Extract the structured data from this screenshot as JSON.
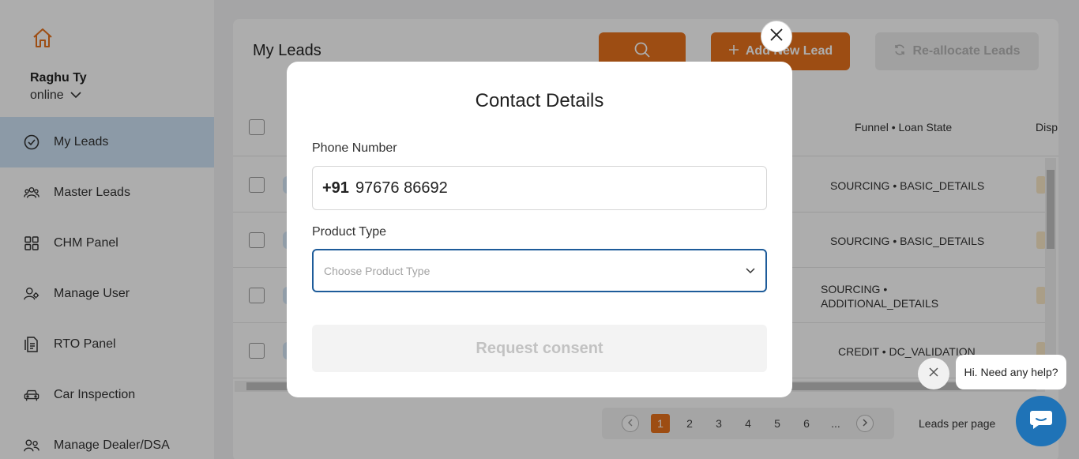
{
  "sidebar": {
    "user_name": "Raghu Ty",
    "user_status": "online",
    "items": [
      {
        "label": "My Leads",
        "icon": "check-circle-icon",
        "active": true
      },
      {
        "label": "Master Leads",
        "icon": "users-icon"
      },
      {
        "label": "CHM Panel",
        "icon": "grid-icon"
      },
      {
        "label": "Manage User",
        "icon": "user-gear-icon"
      },
      {
        "label": "RTO Panel",
        "icon": "document-icon"
      },
      {
        "label": "Car Inspection",
        "icon": "car-icon"
      },
      {
        "label": "Manage Dealer/DSA",
        "icon": "users-icon"
      }
    ]
  },
  "main": {
    "title": "My Leads",
    "add_lead_label": "Add New Lead",
    "reallocate_label": "Re-allocate Leads",
    "columns": {
      "funnel": "Funnel • Loan State",
      "disposition": "Disp"
    },
    "rows": [
      {
        "state": "SOURCING • BASIC_DETAILS"
      },
      {
        "state": "SOURCING • BASIC_DETAILS"
      },
      {
        "state_line1": "SOURCING •",
        "state_line2": "ADDITIONAL_DETAILS"
      },
      {
        "state": "CREDIT • DC_VALIDATION"
      }
    ],
    "pagination": {
      "pages": [
        "1",
        "2",
        "3",
        "4",
        "5",
        "6",
        "..."
      ],
      "current": "1",
      "per_page_label": "Leads per page"
    }
  },
  "modal": {
    "title": "Contact Details",
    "phone_label": "Phone Number",
    "phone_code": "+91",
    "phone_value": "97676 86692",
    "product_label": "Product Type",
    "product_placeholder": "Choose Product Type",
    "submit_label": "Request consent"
  },
  "chat": {
    "greeting": "Hi. Need any help?"
  },
  "colors": {
    "accent": "#e8721c",
    "focus_border": "#1e5c9a",
    "chat_blue": "#1f73b7"
  }
}
